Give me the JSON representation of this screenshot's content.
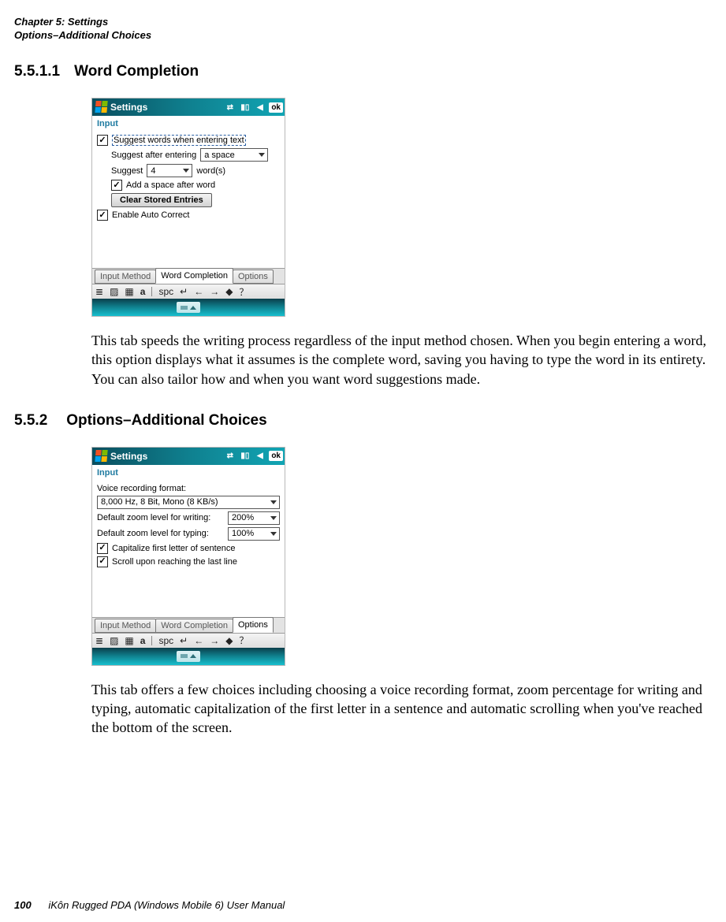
{
  "header": {
    "chapter": "Chapter 5:  Settings",
    "section": "Options–Additional Choices"
  },
  "sec1": {
    "num": "5.5.1.1",
    "title": "Word Completion",
    "body": "This tab speeds the writing process regardless of the input method chosen. When you begin entering a word, this option displays what it assumes is the complete word, saving you having to type the word in its entirety. You can also tailor how and when you want word suggestions made."
  },
  "sec2": {
    "num": "5.5.2",
    "title": "Options–Additional Choices",
    "body": "This tab offers a few choices including choosing a voice recording format, zoom percentage for writing and typing, automatic capitalization of the first letter in a sentence and automatic scrolling when you've reached the bottom of the screen."
  },
  "footer": {
    "page": "100",
    "manual": "iKôn Rugged PDA (Windows Mobile 6) User Manual"
  },
  "wm": {
    "title": "Settings",
    "ok": "ok",
    "panel": "Input",
    "tabs": {
      "inputMethod": "Input Method",
      "wordCompletion": "Word Completion",
      "options": "Options"
    },
    "sip": {
      "spc": "spc",
      "a": "a"
    }
  },
  "shot1": {
    "suggest_label": "Suggest words when entering text",
    "suggest_after_label": "Suggest after entering",
    "suggest_after_value": "a space",
    "suggest_label2": "Suggest",
    "suggest_count": "4",
    "words_label": "word(s)",
    "add_space_label": "Add a space after word",
    "clear_btn": "Clear Stored Entries",
    "auto_correct_label": "Enable Auto Correct"
  },
  "shot2": {
    "voice_label": "Voice recording format:",
    "voice_value": "8,000 Hz, 8 Bit, Mono (8 KB/s)",
    "writing_zoom_label": "Default zoom level for writing:",
    "writing_zoom_value": "200%",
    "typing_zoom_label": "Default zoom level for typing:",
    "typing_zoom_value": "100%",
    "cap_label": "Capitalize first letter of sentence",
    "scroll_label": "Scroll upon reaching the last line"
  }
}
